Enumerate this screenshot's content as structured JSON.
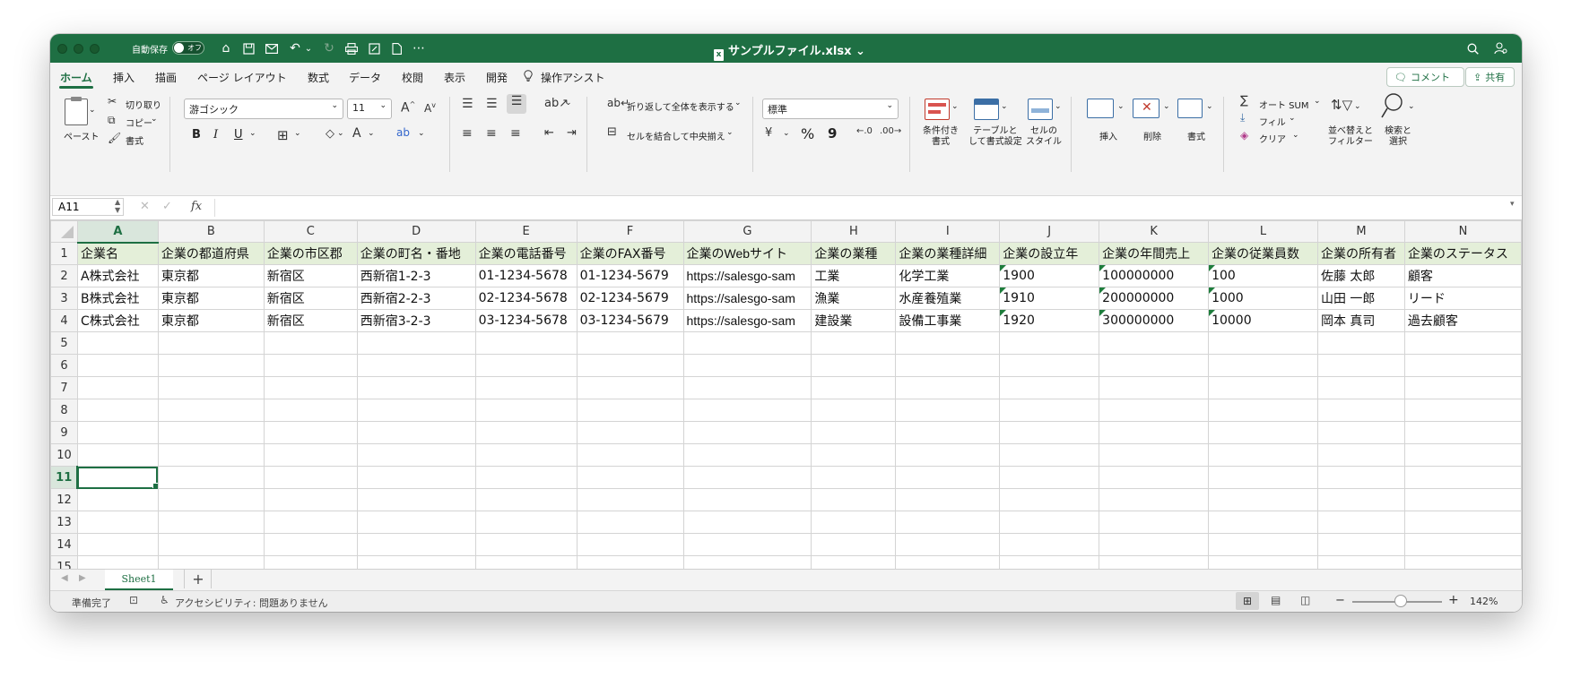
{
  "titlebar": {
    "autosave_label": "自動保存",
    "autosave_state": "オフ",
    "file_name": "サンプルファイル.xlsx",
    "file_chevron": "⌄"
  },
  "menu_tabs": [
    "ホーム",
    "挿入",
    "描画",
    "ページ レイアウト",
    "数式",
    "データ",
    "校閲",
    "表示",
    "開発"
  ],
  "tell_me": "操作アシスト",
  "comment_button": "コメント",
  "share_button": "共有",
  "ribbon": {
    "paste": "ペースト",
    "cut": "切り取り",
    "copy": "コピー",
    "format_painter": "書式",
    "font_name": "游ゴシック",
    "font_size": "11",
    "bold": "B",
    "italic": "I",
    "underline": "U",
    "wrap_text": "折り返して全体を表示する",
    "merge_center": "セルを結合して中央揃え",
    "number_format": "標準",
    "percent": "%",
    "comma": "9",
    "conditional_formatting": "条件付き\n書式",
    "format_as_table": "テーブルと\nして書式設定",
    "cell_styles": "セルの\nスタイル",
    "insert": "挿入",
    "delete": "削除",
    "format": "書式",
    "autosum": "オート SUM",
    "fill": "フィル",
    "clear": "クリア",
    "sort_filter": "並べ替えと\nフィルター",
    "find_select": "検索と\n選択"
  },
  "formula_bar": {
    "name_box": "A11",
    "fx": "fx",
    "value": ""
  },
  "grid": {
    "columns": [
      "A",
      "B",
      "C",
      "D",
      "E",
      "F",
      "G",
      "H",
      "I",
      "J",
      "K",
      "L",
      "M",
      "N"
    ],
    "row_numbers": [
      "1",
      "2",
      "3",
      "4",
      "5",
      "6",
      "7",
      "8",
      "9",
      "10",
      "11",
      "12",
      "13",
      "14",
      "15"
    ],
    "active_cell": "A11",
    "rows": [
      [
        "企業名",
        "企業の都道府県",
        "企業の市区郡",
        "企業の町名・番地",
        "企業の電話番号",
        "企業のFAX番号",
        "企業のWebサイト",
        "企業の業種",
        "企業の業種詳細",
        "企業の設立年",
        "企業の年間売上",
        "企業の従業員数",
        "企業の所有者",
        "企業のステータス"
      ],
      [
        "A株式会社",
        "東京都",
        "新宿区",
        "西新宿1-2-3",
        "01-1234-5678",
        "01-1234-5679",
        "https://salesgo-sam",
        "工業",
        "化学工業",
        "1900",
        "100000000",
        "100",
        "佐藤 太郎",
        "顧客"
      ],
      [
        "B株式会社",
        "東京都",
        "新宿区",
        "西新宿2-2-3",
        "02-1234-5678",
        "02-1234-5679",
        "https://salesgo-sam",
        "漁業",
        "水産養殖業",
        "1910",
        "200000000",
        "1000",
        "山田 一郎",
        "リード"
      ],
      [
        "C株式会社",
        "東京都",
        "新宿区",
        "西新宿3-2-3",
        "03-1234-5678",
        "03-1234-5679",
        "https://salesgo-sam",
        "建設業",
        "設備工事業",
        "1920",
        "300000000",
        "10000",
        "岡本 真司",
        "過去顧客"
      ]
    ]
  },
  "sheet_tabs": [
    "Sheet1"
  ],
  "add_sheet": "+",
  "status": {
    "ready": "準備完了",
    "accessibility": "アクセシビリティ: 問題ありません",
    "zoom_minus": "−",
    "zoom_plus": "+",
    "zoom": "142%",
    "zoom_level": 0.54
  },
  "colors": {
    "excel_green": "#1e6f43",
    "header_row_fill": "#e4efd9"
  },
  "icons": [
    "close-dot-icon",
    "home-icon",
    "save-icon",
    "mail-icon",
    "undo-icon",
    "redo-icon",
    "print-icon",
    "file-icon",
    "more-icon",
    "search-icon",
    "account-icon"
  ]
}
